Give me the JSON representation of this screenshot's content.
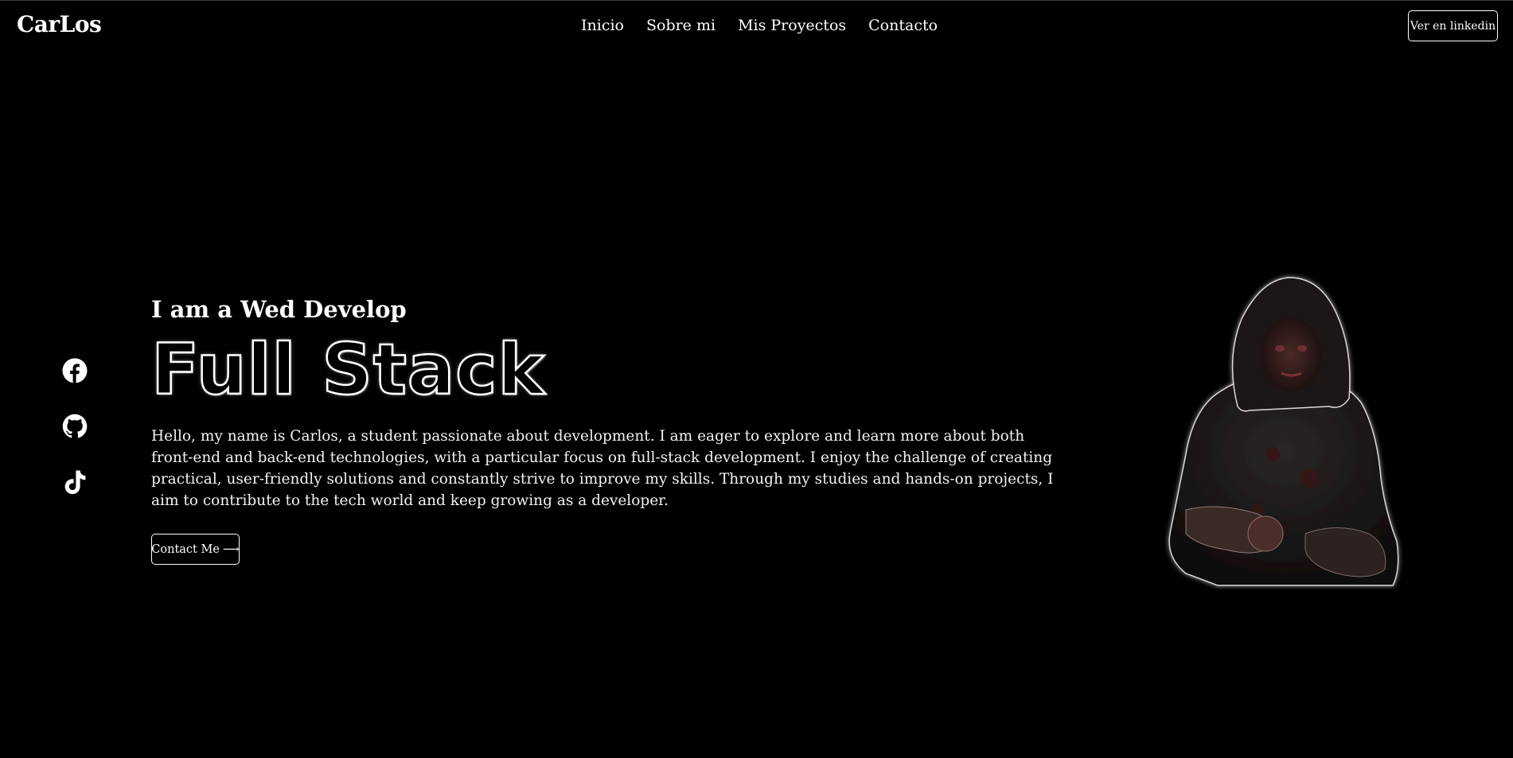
{
  "header": {
    "logo": "CarLos",
    "nav": [
      {
        "label": "Inicio"
      },
      {
        "label": "Sobre mi"
      },
      {
        "label": "Mis Proyectos"
      },
      {
        "label": "Contacto"
      }
    ],
    "linkedin_label": "Ver en linkedin"
  },
  "social": {
    "icons": [
      "facebook-icon",
      "github-icon",
      "tiktok-icon"
    ]
  },
  "hero": {
    "subtitle": "I am a Wed Develop",
    "title": "Full Stack",
    "text": "Hello, my name is Carlos, a student passionate about development. I am eager to explore and learn more about both front-end and back-end technologies, with a particular focus on full-stack development. I enjoy the challenge of creating practical, user-friendly solutions and constantly strive to improve my skills. Through my studies and hands-on projects, I aim to contribute to the tech world and keep growing as a developer.",
    "contact_label": "Contact Me",
    "contact_arrow": "⟶"
  },
  "colors": {
    "background": "#000000",
    "foreground": "#ffffff"
  }
}
